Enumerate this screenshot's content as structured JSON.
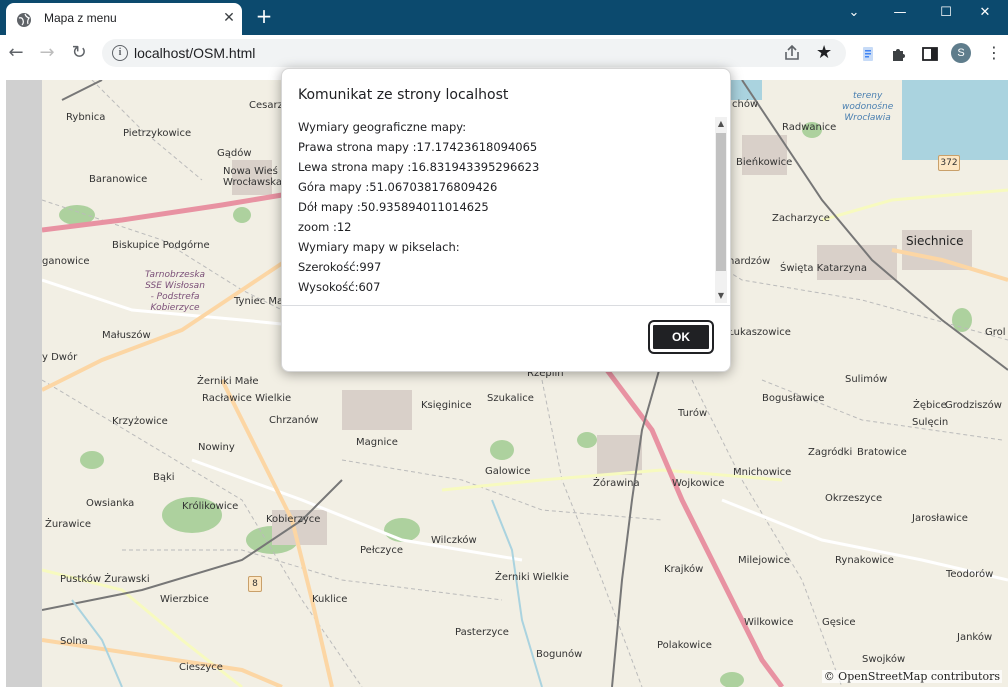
{
  "browser": {
    "tab_title": "Mapa z menu",
    "url": "localhost/OSM.html",
    "profile_initial": "S"
  },
  "map": {
    "attribution": "© OpenStreetMap contributors",
    "route_shields": [
      "372",
      "8"
    ],
    "places": [
      {
        "name": "Rybnica",
        "cls": ""
      },
      {
        "name": "Cesarzo",
        "cls": ""
      },
      {
        "name": "Pietrzykowice",
        "cls": ""
      },
      {
        "name": "Gądów",
        "cls": ""
      },
      {
        "name": "Nowa Wieś Wrocławska",
        "cls": ""
      },
      {
        "name": "Baranowice",
        "cls": ""
      },
      {
        "name": "Biskupice Podgórne",
        "cls": ""
      },
      {
        "name": "ganowice",
        "cls": ""
      },
      {
        "name": "Tarnobrzeska\nSSE Wisłosan\n- Podstrefa\nKobierzyce",
        "cls": "italic"
      },
      {
        "name": "Tyniec Ma",
        "cls": ""
      },
      {
        "name": "Małuszów",
        "cls": ""
      },
      {
        "name": "y Dwór",
        "cls": ""
      },
      {
        "name": "Żerniki Małe",
        "cls": ""
      },
      {
        "name": "Racławice Wielkie",
        "cls": ""
      },
      {
        "name": "Krzyżowice",
        "cls": ""
      },
      {
        "name": "Chrzanów",
        "cls": ""
      },
      {
        "name": "Nowiny",
        "cls": ""
      },
      {
        "name": "Bąki",
        "cls": ""
      },
      {
        "name": "Owsianka",
        "cls": ""
      },
      {
        "name": "Królikowice",
        "cls": ""
      },
      {
        "name": "Kobierzyce",
        "cls": ""
      },
      {
        "name": "Żurawice",
        "cls": ""
      },
      {
        "name": "Pustków Żurawski",
        "cls": ""
      },
      {
        "name": "Wierzbice",
        "cls": ""
      },
      {
        "name": "Solna",
        "cls": ""
      },
      {
        "name": "Cieszyce",
        "cls": ""
      },
      {
        "name": "Kuklice",
        "cls": ""
      },
      {
        "name": "Pełczyce",
        "cls": ""
      },
      {
        "name": "Wilczków",
        "cls": ""
      },
      {
        "name": "Magnice",
        "cls": ""
      },
      {
        "name": "Księginice",
        "cls": ""
      },
      {
        "name": "Szukalice",
        "cls": ""
      },
      {
        "name": "Rzeplin",
        "cls": ""
      },
      {
        "name": "Galowice",
        "cls": ""
      },
      {
        "name": "Żerniki Wielkie",
        "cls": ""
      },
      {
        "name": "Pasterzyce",
        "cls": ""
      },
      {
        "name": "Bogunów",
        "cls": ""
      },
      {
        "name": "Żórawina",
        "cls": ""
      },
      {
        "name": "Turów",
        "cls": ""
      },
      {
        "name": "Wojkowice",
        "cls": ""
      },
      {
        "name": "Krajków",
        "cls": ""
      },
      {
        "name": "Polakowice",
        "cls": ""
      },
      {
        "name": "Milejowice",
        "cls": ""
      },
      {
        "name": "Wilkowice",
        "cls": ""
      },
      {
        "name": "Mnichowice",
        "cls": ""
      },
      {
        "name": "Okrzeszyce",
        "cls": ""
      },
      {
        "name": "Zagródki",
        "cls": ""
      },
      {
        "name": "Bratowice",
        "cls": ""
      },
      {
        "name": "Rynakowice",
        "cls": ""
      },
      {
        "name": "Gęsice",
        "cls": ""
      },
      {
        "name": "Swojków",
        "cls": ""
      },
      {
        "name": "Janków",
        "cls": ""
      },
      {
        "name": "Teodorów",
        "cls": ""
      },
      {
        "name": "Jarosławice",
        "cls": ""
      },
      {
        "name": "Sulęcin",
        "cls": ""
      },
      {
        "name": "Grodziszów",
        "cls": ""
      },
      {
        "name": "Żębice",
        "cls": ""
      },
      {
        "name": "Sulimów",
        "cls": ""
      },
      {
        "name": "Bogusławice",
        "cls": ""
      },
      {
        "name": "Łukaszowice",
        "cls": ""
      },
      {
        "name": "Grol",
        "cls": ""
      },
      {
        "name": "Siechnice",
        "cls": "big"
      },
      {
        "name": "Święta Katarzyna",
        "cls": ""
      },
      {
        "name": "nardzów",
        "cls": ""
      },
      {
        "name": "Zacharzyce",
        "cls": ""
      },
      {
        "name": "Bieńkowice",
        "cls": ""
      },
      {
        "name": "Radwanice",
        "cls": ""
      },
      {
        "name": "chów",
        "cls": ""
      },
      {
        "name": "tereny\nwodonośne\nWrocławia",
        "cls": "water"
      }
    ]
  },
  "dialog": {
    "title": "Komunikat ze strony localhost",
    "lines": [
      "Wymiary geograficzne mapy:",
      "Prawa strona mapy :17.17423618094065",
      "Lewa strona mapy :16.831943395296623",
      "Góra mapy :51.067038176809426",
      "Dół mapy :50.935894011014625",
      "zoom :12",
      "Wymiary mapy w pikselach:",
      "Szerokość:997",
      "Wysokość:607"
    ],
    "ok_label": "OK"
  },
  "colors": {
    "titlebar": "#0c4a6e",
    "map_background": "#f2efe4",
    "motorway": "#e892a2",
    "primary_road": "#fcd6a4",
    "forest": "#add19e",
    "water": "#aad3df"
  }
}
